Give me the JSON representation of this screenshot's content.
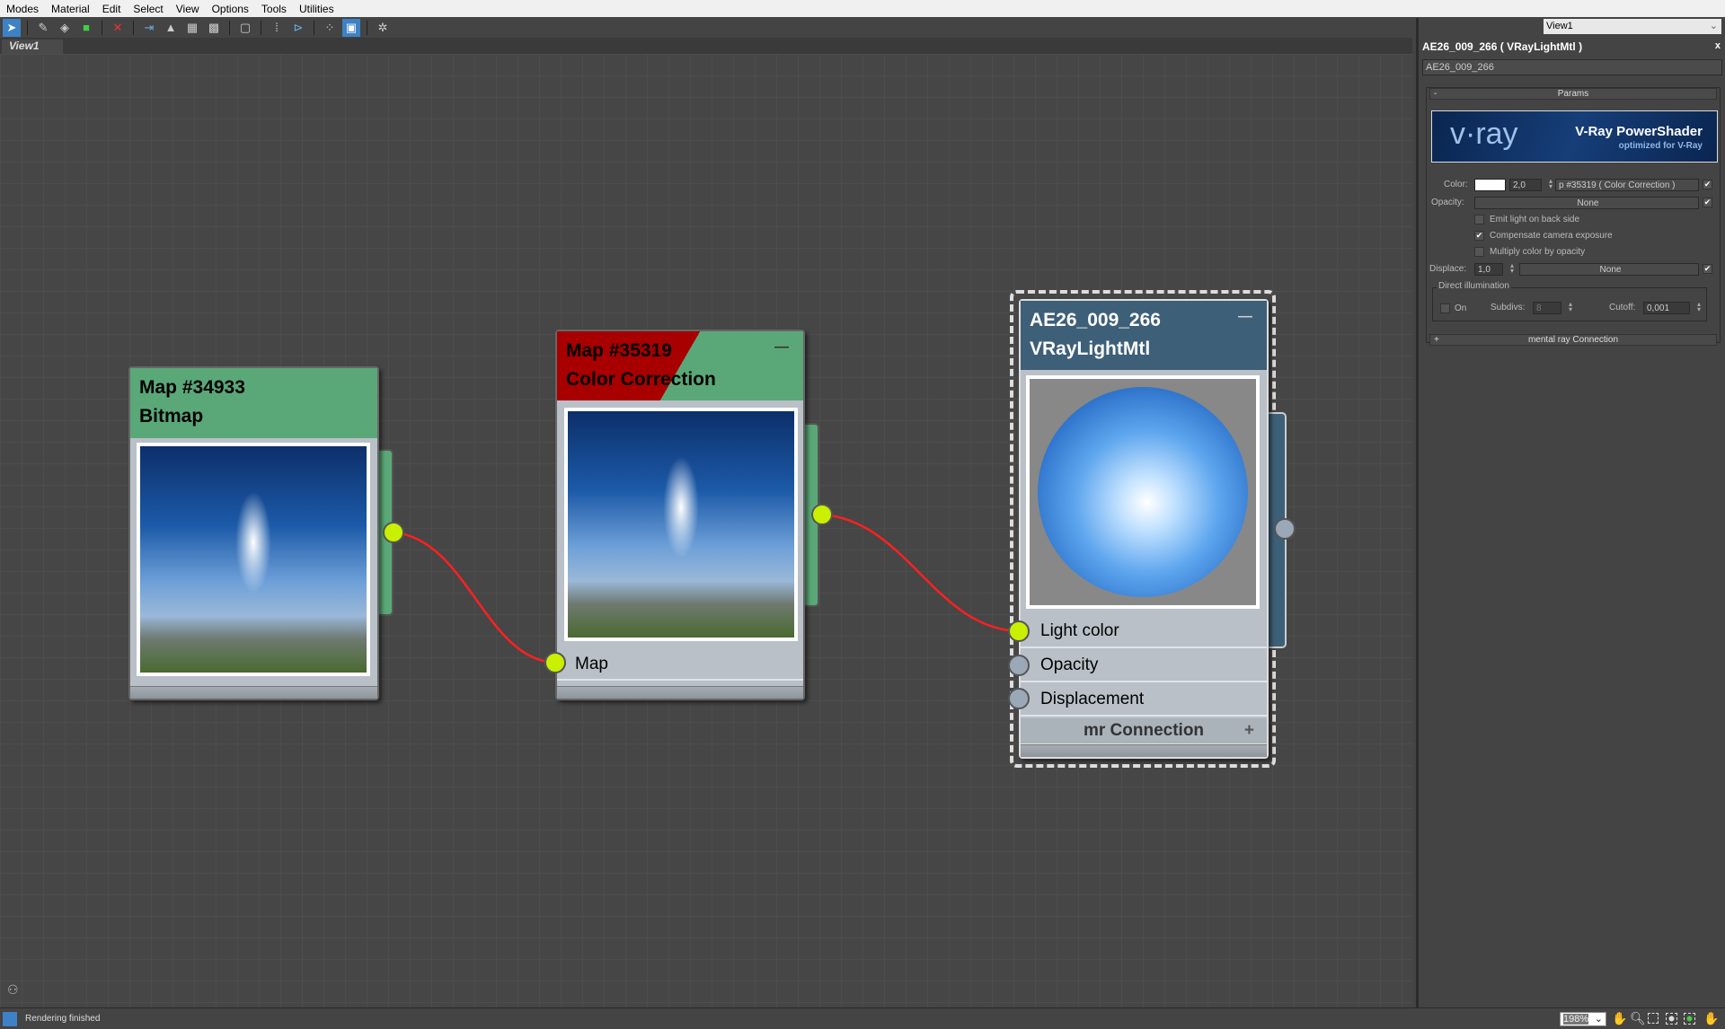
{
  "menu": [
    "Modes",
    "Material",
    "Edit",
    "Select",
    "View",
    "Options",
    "Tools",
    "Utilities"
  ],
  "toolbar_icons": [
    "select-arrow-icon",
    "eyedropper-icon",
    "put-material-icon",
    "assign-material-icon",
    "delete-icon",
    "move-children-icon",
    "select-by-material-icon",
    "show-map-in-viewport-icon",
    "background-icon",
    "material-preview-icon",
    "layout-icon",
    "layout-children-icon",
    "hide-unused-icon",
    "parameter-editor-icon",
    "render-map-icon"
  ],
  "tab": "View1",
  "view_select": "View1",
  "nodes": {
    "bitmap": {
      "line1": "Map #34933",
      "line2": "Bitmap"
    },
    "cc": {
      "line1": "Map #35319",
      "line2": "Color Correction",
      "input": "Map",
      "minimize": "—"
    },
    "mtl": {
      "line1": "AE26_009_266",
      "line2": "VRayLightMtl",
      "minimize": "—",
      "inputs": [
        "Light color",
        "Opacity",
        "Displacement"
      ],
      "rollout": "mr Connection",
      "rollout_toggle": "+"
    }
  },
  "colors": {
    "bitmap_header": "#5aa878",
    "cc_error": "#a80000",
    "mtl_header": "#3e5f78",
    "socket_connected": "#c8f000",
    "wire": "#ff2020"
  },
  "panel": {
    "title": "AE26_009_266  ( VRayLightMtl )",
    "close": "x",
    "name_value": "AE26_009_266",
    "params_toggle": "-",
    "params_label": "Params",
    "banner_logo": "v·ray",
    "banner_title": "V-Ray PowerShader",
    "banner_sub": "optimized for V-Ray",
    "color_label": "Color:",
    "color_mult": "2,0",
    "color_map": "p #35319  ( Color Correction )",
    "opacity_label": "Opacity:",
    "opacity_map": "None",
    "emit_back": "Emit light on back side",
    "compensate": "Compensate camera exposure",
    "multiply": "Multiply color by opacity",
    "displace_label": "Displace:",
    "displace_value": "1,0",
    "displace_map": "None",
    "direct_group": "Direct illumination",
    "on_label": "On",
    "subdivs_label": "Subdivs:",
    "subdivs_value": "8",
    "cutoff_label": "Cutoff:",
    "cutoff_value": "0,001",
    "mr_toggle": "+",
    "mr_label": "mental ray Connection",
    "check": "✔",
    "checks": {
      "color": true,
      "opacity": true,
      "emit_back": false,
      "compensate": true,
      "multiply": false,
      "displace": true,
      "direct_on": false
    }
  },
  "status": {
    "text": "Rendering finished",
    "zoom": "198%"
  }
}
